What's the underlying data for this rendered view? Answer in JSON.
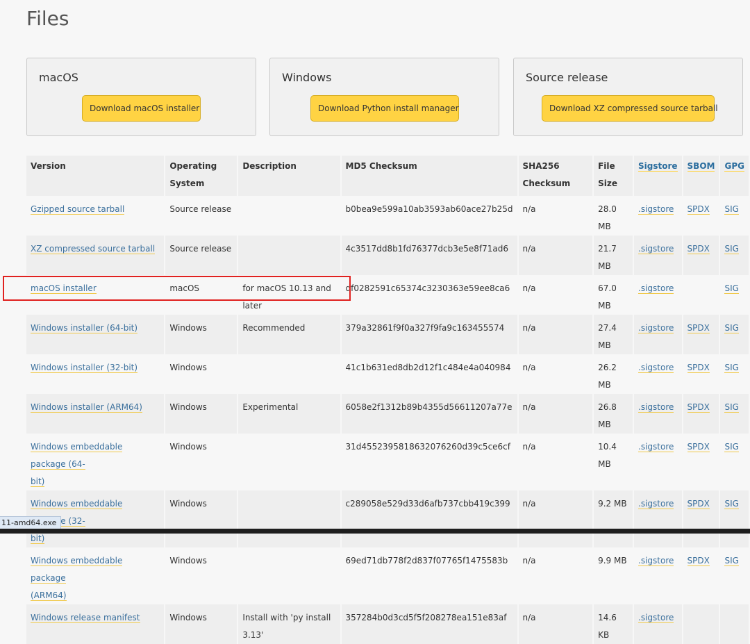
{
  "page": {
    "title": "Files"
  },
  "cards": {
    "macos": {
      "title": "macOS",
      "button": "Download macOS installer"
    },
    "windows": {
      "title": "Windows",
      "button": "Download Python install manager"
    },
    "source": {
      "title": "Source release",
      "button": "Download XZ compressed source tarball"
    }
  },
  "table": {
    "headers": {
      "version": "Version",
      "os_line1": "Operating",
      "os_line2": "System",
      "description": "Description",
      "md5": "MD5 Checksum",
      "sha_line1": "SHA256",
      "sha_line2": "Checksum",
      "size_line1": "File",
      "size_line2": "Size",
      "sigstore": "Sigstore",
      "sbom": "SBOM",
      "gpg": "GPG"
    },
    "rows": [
      {
        "version": "Gzipped source tarball",
        "os": "Source release",
        "description": "",
        "md5": "b0bea9e599a10ab3593ab60ace27b25d",
        "sha256": "n/a",
        "size": "28.0 MB",
        "sigstore": ".sigstore",
        "sbom": "SPDX",
        "gpg": "SIG"
      },
      {
        "version": "XZ compressed source tarball",
        "os": "Source release",
        "description": "",
        "md5": "4c3517dd8b1fd76377dcb3e5e8f71ad6",
        "sha256": "n/a",
        "size": "21.7 MB",
        "sigstore": ".sigstore",
        "sbom": "SPDX",
        "gpg": "SIG"
      },
      {
        "version": "macOS installer",
        "os": "macOS",
        "description_line1": "for macOS 10.13 and",
        "description_line2": "later",
        "md5": "df0282591c65374c3230363e59ee8ca6",
        "sha256": "n/a",
        "size": "67.0 MB",
        "sigstore": ".sigstore",
        "sbom": "",
        "gpg": "SIG"
      },
      {
        "version": "Windows installer (64-bit)",
        "os": "Windows",
        "description": "Recommended",
        "md5": "379a32861f9f0a327f9fa9c163455574",
        "sha256": "n/a",
        "size": "27.4 MB",
        "sigstore": ".sigstore",
        "sbom": "SPDX",
        "gpg": "SIG"
      },
      {
        "version": "Windows installer (32-bit)",
        "os": "Windows",
        "description": "",
        "md5": "41c1b631ed8db2d12f1c484e4a040984",
        "sha256": "n/a",
        "size": "26.2 MB",
        "sigstore": ".sigstore",
        "sbom": "SPDX",
        "gpg": "SIG"
      },
      {
        "version": "Windows installer (ARM64)",
        "os": "Windows",
        "description": "Experimental",
        "md5": "6058e2f1312b89b4355d56611207a77e",
        "sha256": "n/a",
        "size": "26.8 MB",
        "sigstore": ".sigstore",
        "sbom": "SPDX",
        "gpg": "SIG"
      },
      {
        "version_line1": "Windows embeddable package (64-",
        "version_line2": "bit)",
        "os": "Windows",
        "description": "",
        "md5": "31d4552395818632076260d39c5ce6cf",
        "sha256": "n/a",
        "size": "10.4 MB",
        "sigstore": ".sigstore",
        "sbom": "SPDX",
        "gpg": "SIG"
      },
      {
        "version_line1": "Windows embeddable package (32-",
        "version_line2": "bit)",
        "os": "Windows",
        "description": "",
        "md5": "c289058e529d33d6afb737cbb419c399",
        "sha256": "n/a",
        "size": "9.2 MB",
        "sigstore": ".sigstore",
        "sbom": "SPDX",
        "gpg": "SIG"
      },
      {
        "version_line1": "Windows embeddable package",
        "version_line2": "(ARM64)",
        "os": "Windows",
        "description": "",
        "md5": "69ed71db778f2d837f07765f1475583b",
        "sha256": "n/a",
        "size": "9.9 MB",
        "sigstore": ".sigstore",
        "sbom": "SPDX",
        "gpg": "SIG"
      },
      {
        "version": "Windows release manifest",
        "os": "Windows",
        "description_line1": "Install with 'py install",
        "description_line2": "3.13'",
        "md5": "357284b0d3cd5f5f208278ea151e83af",
        "sha256": "n/a",
        "size": "14.6 KB",
        "sigstore": ".sigstore",
        "sbom": "",
        "gpg": ""
      }
    ]
  },
  "status_bar": {
    "url": "11-amd64.exe"
  }
}
